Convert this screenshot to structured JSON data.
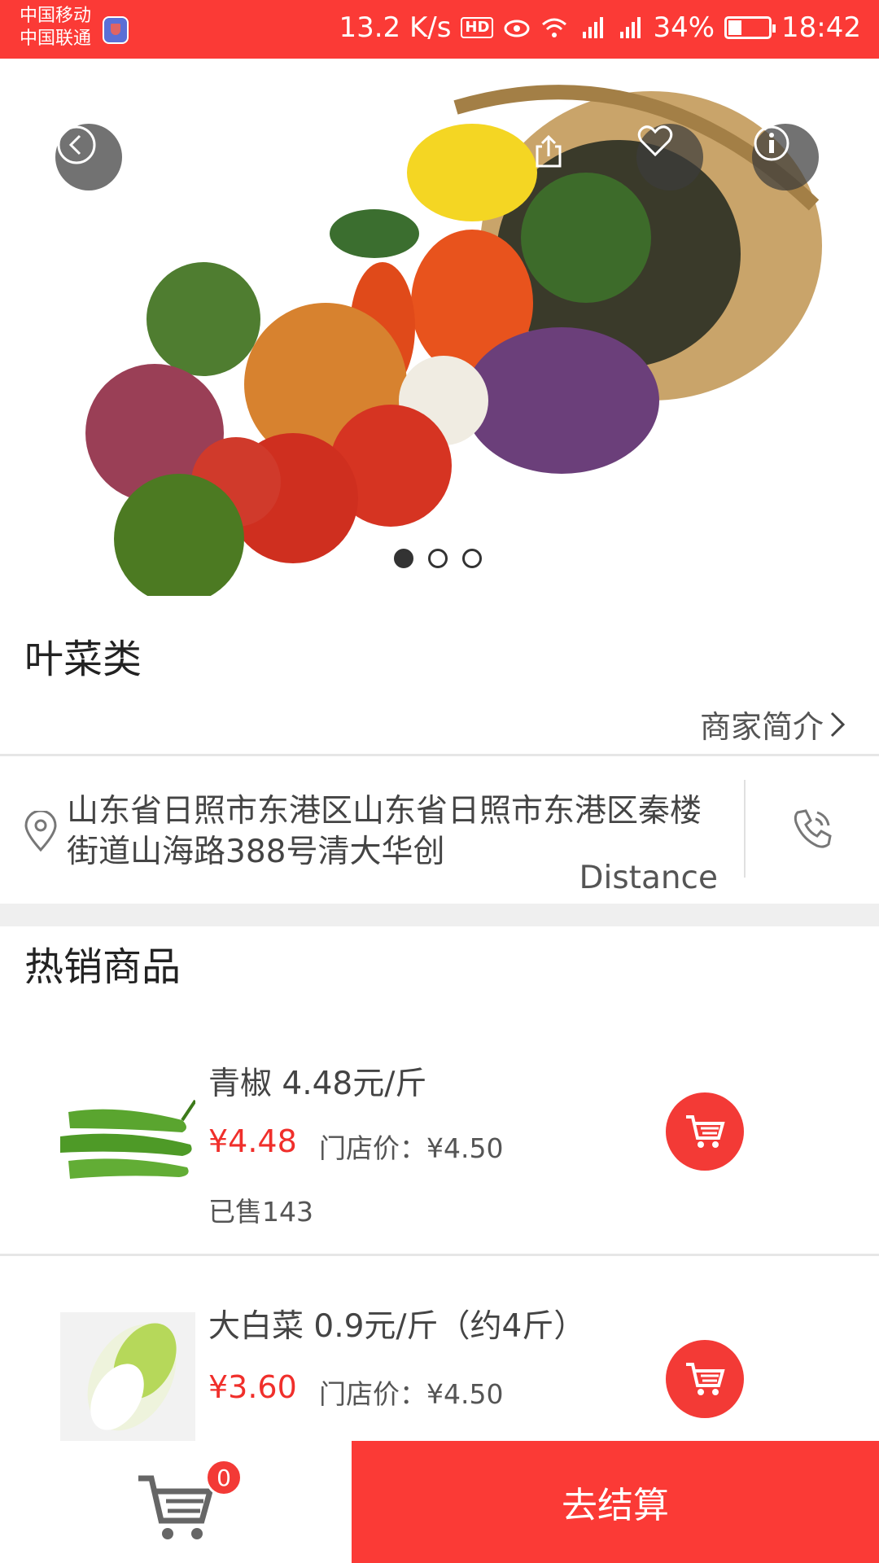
{
  "status_bar": {
    "carrier_1": "中国移动",
    "carrier_2": "中国联通",
    "speed": "13.2 K/s",
    "hd": "HD",
    "battery": "34%",
    "time": "18:42"
  },
  "hero": {
    "carousel_count": 3,
    "active_index": 0
  },
  "store": {
    "category": "叶菜类",
    "intro_link": "商家简介",
    "address": "山东省日照市东港区山东省日照市东港区秦楼街道山海路388号清大华创",
    "distance": "Distance"
  },
  "hot": {
    "title": "热销商品",
    "products": [
      {
        "name": "青椒 4.48元/斤",
        "price": "¥4.48",
        "store_price": "门店价：¥4.50",
        "sold": "已售143"
      },
      {
        "name": "大白菜 0.9元/斤（约4斤）",
        "price": "¥3.60",
        "store_price": "门店价：¥4.50"
      }
    ]
  },
  "bottom_bar": {
    "cart_count": "0",
    "checkout_label": "去结算"
  },
  "colors": {
    "accent": "#fb3a36",
    "price": "#f02f2b"
  }
}
